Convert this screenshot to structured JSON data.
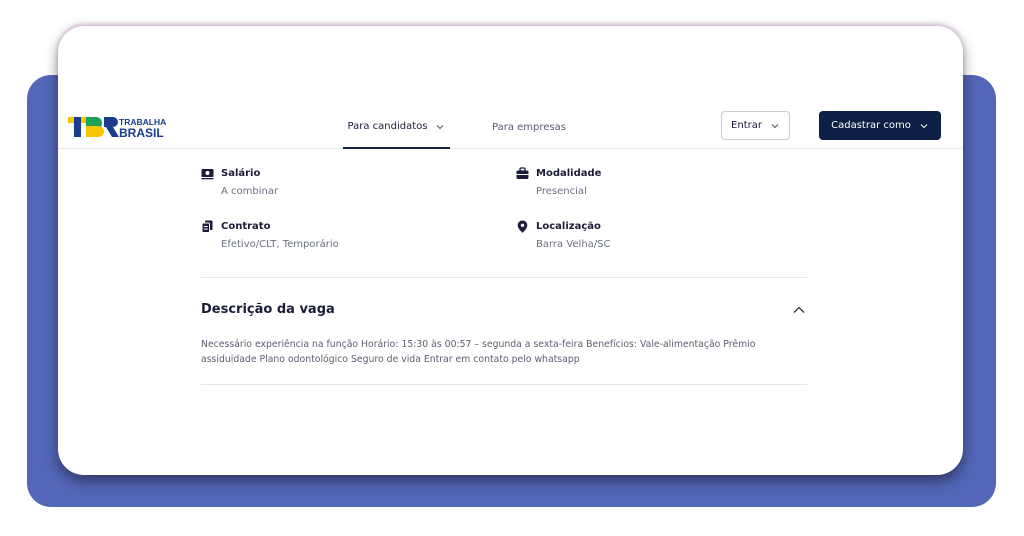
{
  "brand": {
    "logo_line1": "TRABALHA",
    "logo_line2": "BRASIL"
  },
  "nav": {
    "candidates": "Para candidatos",
    "companies": "Para empresas",
    "login": "Entrar",
    "signup": "Cadastrar como"
  },
  "details": {
    "salary": {
      "label": "Salário",
      "value": "A combinar"
    },
    "modality": {
      "label": "Modalidade",
      "value": "Presencial"
    },
    "contract": {
      "label": "Contrato",
      "value": "Efetivo/CLT, Temporário"
    },
    "location": {
      "label": "Localização",
      "value": "Barra Velha/SC"
    }
  },
  "description": {
    "title": "Descrição da vaga",
    "text": "Necessário experiência na função Horário: 15:30 às 00:57 – segunda a sexta-feira Benefícios: Vale-alimentação Prêmio assiduidade Plano odontológico Seguro de vida Entrar em contato pelo whatsapp"
  },
  "colors": {
    "accent": "#0d1f45",
    "backdrop": "#5466b8",
    "logo_yellow": "#f7c400",
    "logo_blue": "#1a3d8f"
  }
}
